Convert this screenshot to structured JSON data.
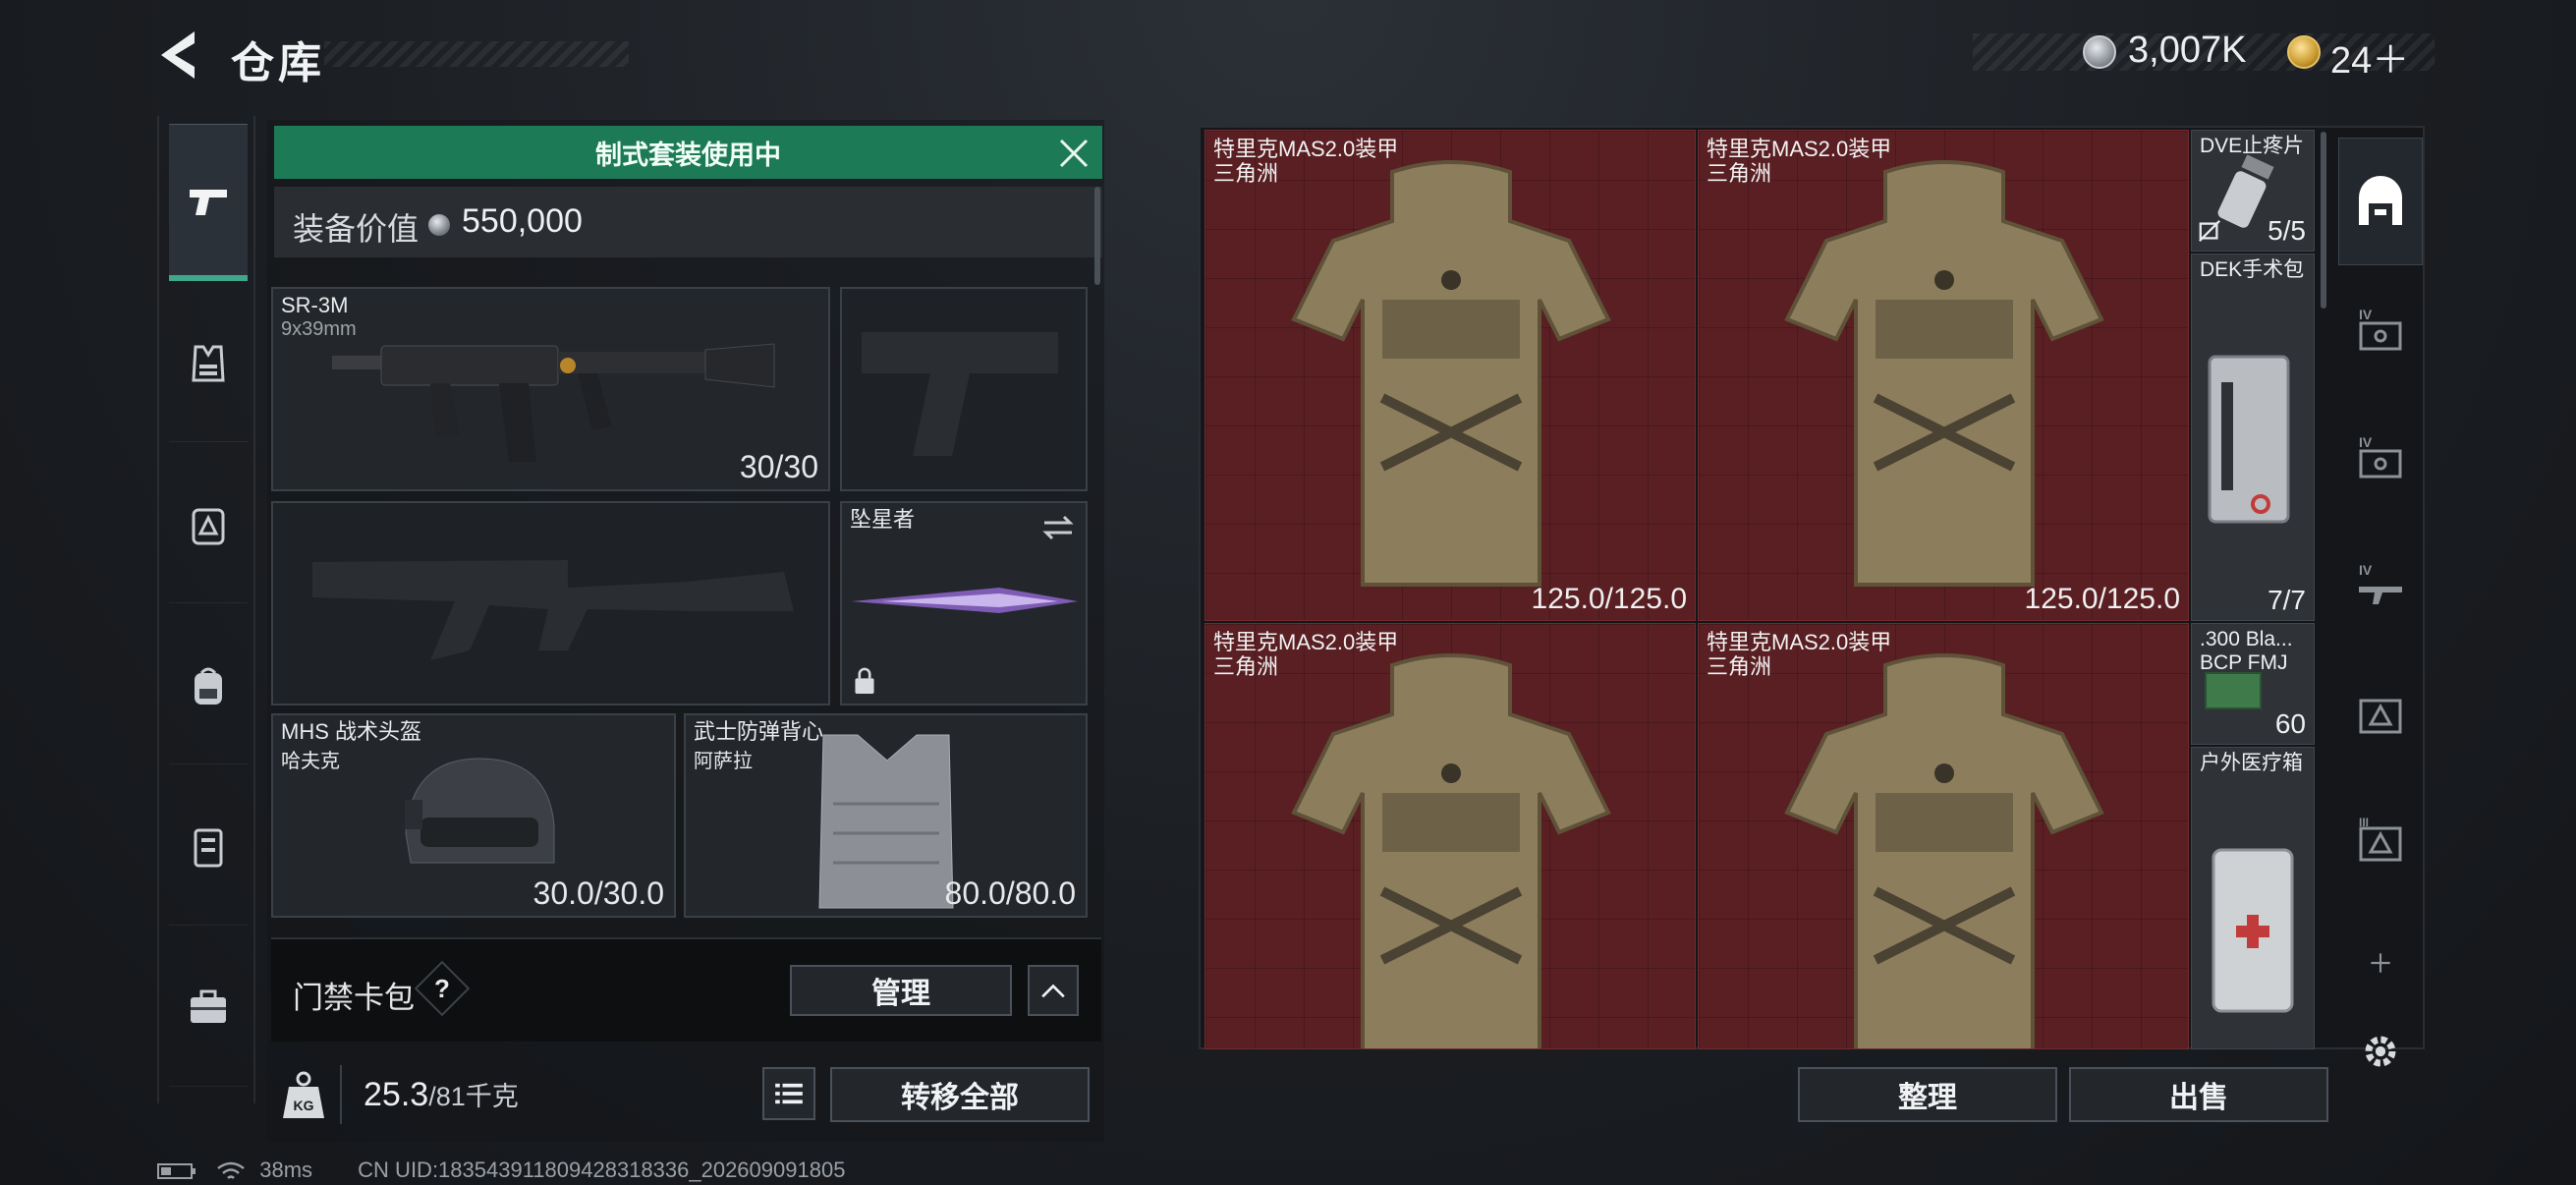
{
  "header": {
    "title": "仓库",
    "currency_amount": "3,007K",
    "ticket_amount": "24＋"
  },
  "left_nav": [
    {
      "icon": "pistol-icon",
      "active": true
    },
    {
      "icon": "armor-vest-icon"
    },
    {
      "icon": "backpack-triangle-icon"
    },
    {
      "icon": "backpack-icon"
    },
    {
      "icon": "rig-icon"
    },
    {
      "icon": "toolbox-icon"
    }
  ],
  "kit": {
    "banner": "制式套装使用中",
    "value_label": "装备价值",
    "value_amount": "550,000"
  },
  "slots": {
    "primary": {
      "name": "SR-3M",
      "sub": "9x39mm",
      "ammo": "30/30"
    },
    "melee": {
      "name": "坠星者"
    },
    "helmet": {
      "name": "MHS 战术头盔",
      "sub": "哈夫克",
      "durability": "30.0/30.0"
    },
    "vest": {
      "name": "武士防弹背心",
      "sub": "阿萨拉",
      "durability": "80.0/80.0"
    }
  },
  "card_pack": {
    "label": "门禁卡包",
    "help": "?",
    "manage": "管理"
  },
  "weight": {
    "current": "25.3",
    "max": "/81千克"
  },
  "buttons": {
    "transfer_all": "转移全部",
    "sort": "整理",
    "sell": "出售"
  },
  "storage": {
    "armors": [
      {
        "name": "特里克MAS2.0装甲",
        "brand": "三角洲",
        "durability": "125.0/125.0"
      },
      {
        "name": "特里克MAS2.0装甲",
        "brand": "三角洲",
        "durability": "125.0/125.0"
      },
      {
        "name": "特里克MAS2.0装甲",
        "brand": "三角洲",
        "durability": ""
      },
      {
        "name": "特里克MAS2.0装甲",
        "brand": "三角洲",
        "durability": ""
      }
    ],
    "items": [
      {
        "name": "DVE止疼片",
        "count": "5/5"
      },
      {
        "name": "DEK手术包",
        "count": "7/7"
      },
      {
        "name": ".300 Bla...",
        "sub": "BCP FMJ",
        "count": "60"
      },
      {
        "name": "户外医疗箱",
        "count": ""
      }
    ]
  },
  "footer": {
    "ping": "38ms",
    "uid": "CN UID:18354391180942831833​6_202609091805"
  }
}
